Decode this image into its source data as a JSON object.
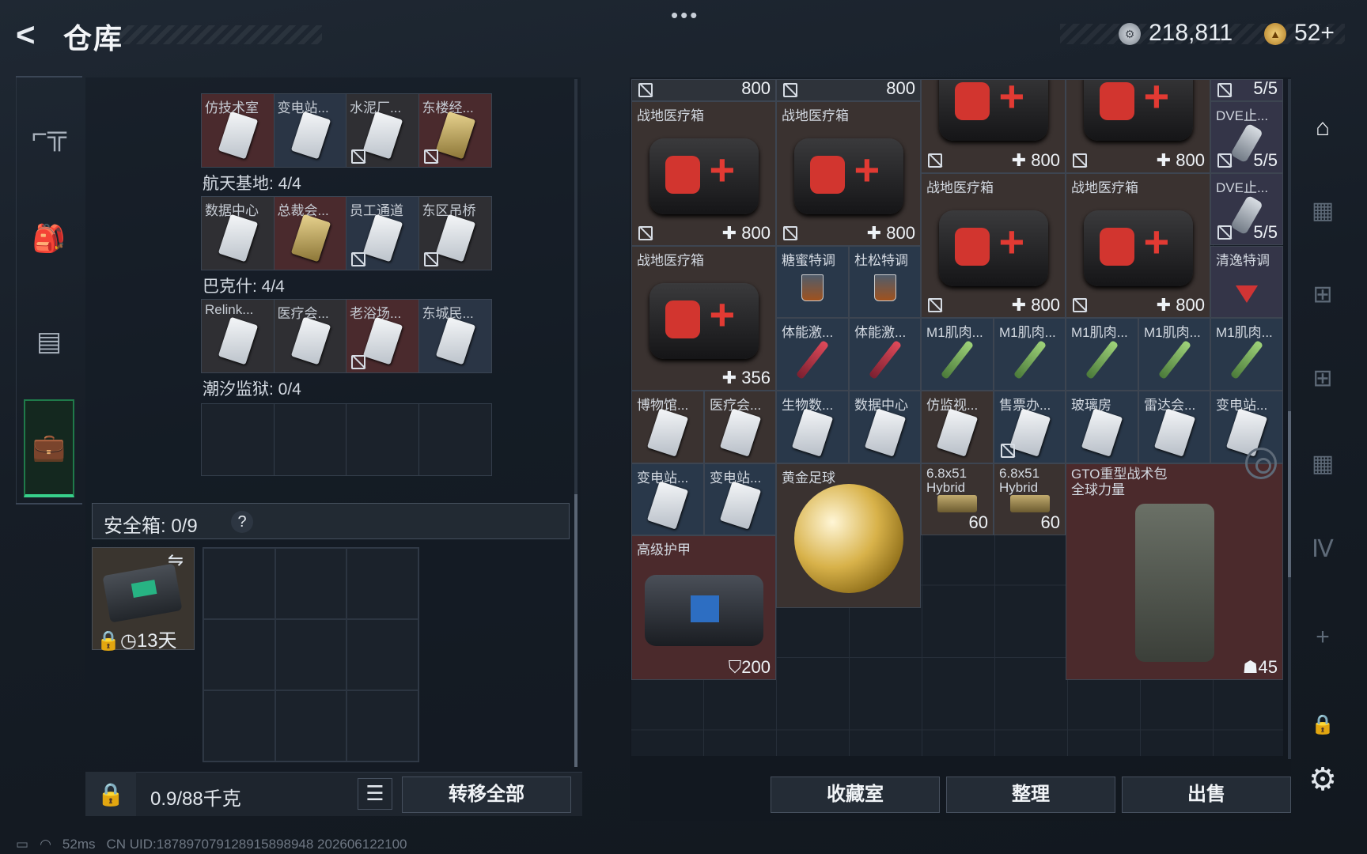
{
  "header": {
    "back_glyph": "<",
    "title": "仓库",
    "menu_dots": "•••",
    "currency": [
      {
        "icon": "silver-coin-icon",
        "value": "218,811"
      },
      {
        "icon": "gold-coin-icon",
        "value": "52+"
      }
    ]
  },
  "nav": {
    "items": [
      {
        "icon": "gun-icon"
      },
      {
        "icon": "backpack-icon"
      },
      {
        "icon": "vest-icon"
      },
      {
        "icon": "briefcase-icon",
        "active": true
      }
    ]
  },
  "collections": [
    {
      "title": "",
      "cells": [
        "仿技术室",
        "变电站...",
        "水泥厂...",
        "东楼经..."
      ]
    },
    {
      "title": "航天基地: 4/4",
      "cells": [
        "数据中心",
        "总裁会...",
        "员工通道",
        "东区吊桥"
      ]
    },
    {
      "title": "巴克什: 4/4",
      "cells": [
        "Relink...",
        "医疗会...",
        "老浴场...",
        "东城民..."
      ]
    },
    {
      "title": "潮汐监狱: 0/4",
      "cells": [
        "",
        "",
        "",
        ""
      ]
    }
  ],
  "safebox": {
    "label": "安全箱: 0/9",
    "help": "?",
    "timer": "13天"
  },
  "footer_left": {
    "weight": "0.9/88千克",
    "transfer_all": "转移全部"
  },
  "status": {
    "ping": "52ms",
    "uid": "CN UID:1878970791289158989​48 202606122100"
  },
  "storage": {
    "items": [
      {
        "name": "",
        "count": "800"
      },
      {
        "name": "",
        "count": "800"
      },
      {
        "name": "",
        "count": "5/5"
      },
      {
        "name": "战地医疗箱",
        "count": "800"
      },
      {
        "name": "战地医疗箱",
        "count": "800"
      },
      {
        "name": "",
        "count": "800"
      },
      {
        "name": "",
        "count": "800"
      },
      {
        "name": "DVE止...",
        "count": "5/5"
      },
      {
        "name": "战地医疗箱",
        "count": "800"
      },
      {
        "name": "战地医疗箱",
        "count": "800"
      },
      {
        "name": "DVE止...",
        "count": "5/5"
      },
      {
        "name": "战地医疗箱",
        "count": "356"
      },
      {
        "name": "糖蜜特调",
        "count": ""
      },
      {
        "name": "杜松特调",
        "count": ""
      },
      {
        "name": "清逸特调",
        "count": ""
      },
      {
        "name": "体能激...",
        "count": ""
      },
      {
        "name": "体能激...",
        "count": ""
      },
      {
        "name": "M1肌肉...",
        "count": ""
      },
      {
        "name": "M1肌肉...",
        "count": ""
      },
      {
        "name": "M1肌肉...",
        "count": ""
      },
      {
        "name": "M1肌肉...",
        "count": ""
      },
      {
        "name": "M1肌肉...",
        "count": ""
      },
      {
        "name": "博物馆...",
        "count": ""
      },
      {
        "name": "医疗会...",
        "count": ""
      },
      {
        "name": "生物数...",
        "count": ""
      },
      {
        "name": "数据中心",
        "count": ""
      },
      {
        "name": "仿监视...",
        "count": ""
      },
      {
        "name": "售票办...",
        "count": ""
      },
      {
        "name": "玻璃房",
        "count": ""
      },
      {
        "name": "雷达会...",
        "count": ""
      },
      {
        "name": "变电站...",
        "count": ""
      },
      {
        "name": "变电站...",
        "count": ""
      },
      {
        "name": "变电站...",
        "count": ""
      },
      {
        "name": "黄金足球",
        "count": ""
      },
      {
        "name": "6.8x51 Hybrid",
        "count": "60"
      },
      {
        "name": "6.8x51 Hybrid",
        "count": "60"
      },
      {
        "name": "GTO重型战术包\n全球力量",
        "count": "45"
      },
      {
        "name": "高级护甲",
        "count": "200"
      }
    ]
  },
  "footer_right": {
    "collection_room": "收藏室",
    "sort": "整理",
    "sell": "出售"
  },
  "sidebar_right": {
    "plus": "+",
    "icons": [
      "base-icon",
      "folder-icon",
      "add-box-icon",
      "add-box-icon",
      "folder-icon",
      "tier-icon",
      "add-icon",
      "lock-icon",
      "gear-icon"
    ]
  }
}
